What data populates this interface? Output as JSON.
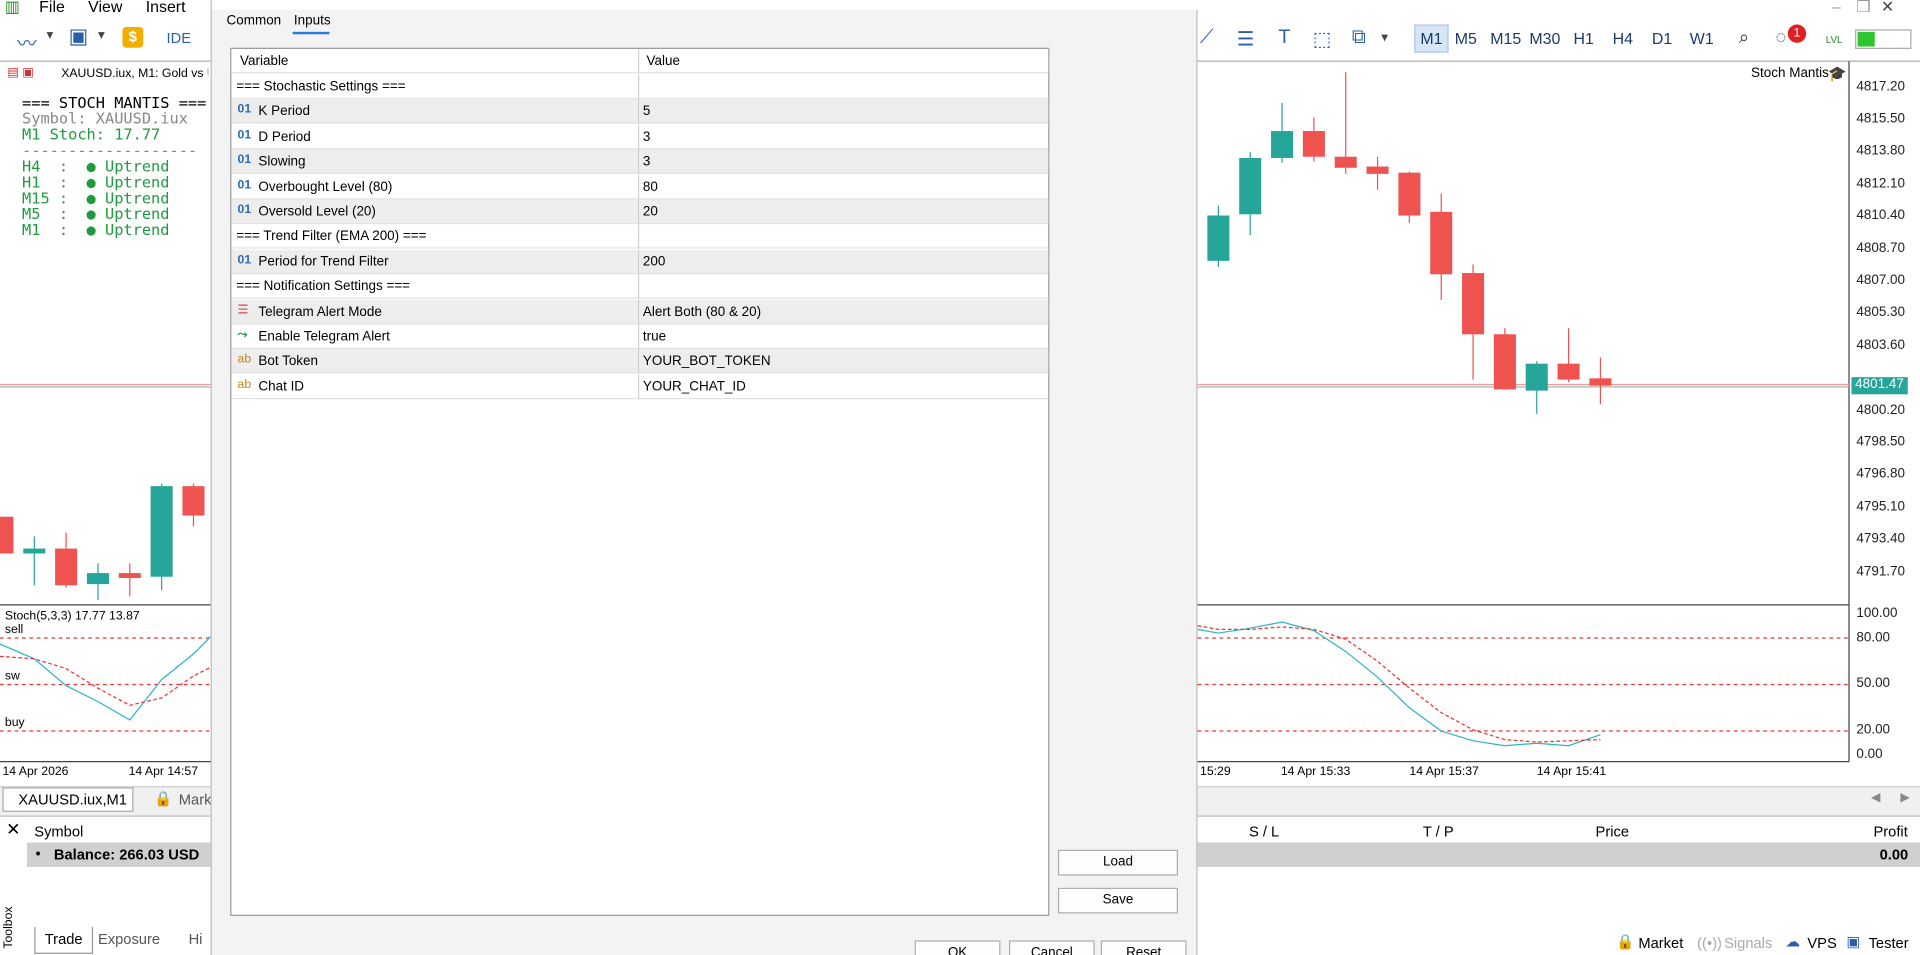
{
  "menu": {
    "file": "File",
    "view": "View",
    "insert": "Insert"
  },
  "toolbar": {
    "ide": "IDE",
    "timeframes": [
      "M1",
      "M5",
      "M15",
      "M30",
      "H1",
      "H4",
      "D1",
      "W1"
    ],
    "active_tf": "M1",
    "notif_count": "1",
    "lvl": "LVL"
  },
  "chart": {
    "title": "XAUUSD.iux, M1:  Gold vs U",
    "indicator_name": "Stoch Mantis",
    "current_price": "4801.47",
    "prices": [
      "4817.20",
      "4815.50",
      "4813.80",
      "4812.10",
      "4810.40",
      "4808.70",
      "4807.00",
      "4805.30",
      "4803.60",
      "4800.20",
      "4798.50",
      "4796.80",
      "4795.10",
      "4793.40",
      "4791.70"
    ],
    "stoch_label": "Stoch(5,3,3) 17.77 13.87",
    "stoch_levels": [
      "100.00",
      "80.00",
      "50.00",
      "20.00",
      "0.00"
    ],
    "stoch_tags": {
      "sell": "sell",
      "sw": "sw",
      "buy": "buy"
    },
    "time_labels": [
      "14 Apr 2026",
      "14 Apr 14:57",
      "15:29",
      "14 Apr 15:33",
      "14 Apr 15:37",
      "14 Apr 15:41"
    ]
  },
  "info_panel": {
    "title": "=== STOCH MANTIS ===",
    "symbol": "Symbol: XAUUSD.iux",
    "stoch": "M1 Stoch: 17.77",
    "divider": "-------------------",
    "trends": [
      "H4  :  ● Uptrend",
      "H1  :  ● Uptrend",
      "M15 :  ● Uptrend",
      "M5  :  ● Uptrend",
      "M1  :  ● Uptrend"
    ]
  },
  "chart_tab": {
    "label": "XAUUSD.iux,M1",
    "market_tab": "Mark"
  },
  "toolbox": {
    "label": "Toolbox",
    "symbol_header": "Symbol",
    "balance": "Balance: 266.03 USD",
    "sl": "S / L",
    "tp": "T / P",
    "price": "Price",
    "profit": "Profit",
    "profit_value": "0.00",
    "tabs": [
      "Trade",
      "Exposure",
      "Hi"
    ]
  },
  "status": {
    "market": "Market",
    "signals": "Signals",
    "vps": "VPS",
    "tester": "Tester"
  },
  "dialog": {
    "tabs": [
      "Common",
      "Inputs"
    ],
    "active_tab": "Inputs",
    "col_variable": "Variable",
    "col_value": "Value",
    "rows": [
      {
        "type": "section",
        "name": "=== Stochastic Settings ===",
        "value": ""
      },
      {
        "type": "int",
        "name": "K Period",
        "value": "5"
      },
      {
        "type": "int",
        "name": "D Period",
        "value": "3"
      },
      {
        "type": "int",
        "name": "Slowing",
        "value": "3"
      },
      {
        "type": "int",
        "name": "Overbought Level (80)",
        "value": "80"
      },
      {
        "type": "int",
        "name": "Oversold Level (20)",
        "value": "20"
      },
      {
        "type": "section",
        "name": "=== Trend Filter (EMA 200) ===",
        "value": ""
      },
      {
        "type": "int",
        "name": "Period for Trend Filter",
        "value": "200"
      },
      {
        "type": "section",
        "name": "=== Notification Settings ===",
        "value": ""
      },
      {
        "type": "enum",
        "name": "Telegram Alert Mode",
        "value": "Alert Both (80 & 20)"
      },
      {
        "type": "bool",
        "name": "Enable Telegram Alert",
        "value": "true"
      },
      {
        "type": "str",
        "name": "Bot Token",
        "value": "YOUR_BOT_TOKEN"
      },
      {
        "type": "str",
        "name": "Chat ID",
        "value": "YOUR_CHAT_ID"
      }
    ],
    "load": "Load",
    "save": "Save",
    "ok": "OK",
    "cancel": "Cancel",
    "reset": "Reset",
    "type_icons": {
      "int": "01",
      "str": "ab"
    }
  }
}
